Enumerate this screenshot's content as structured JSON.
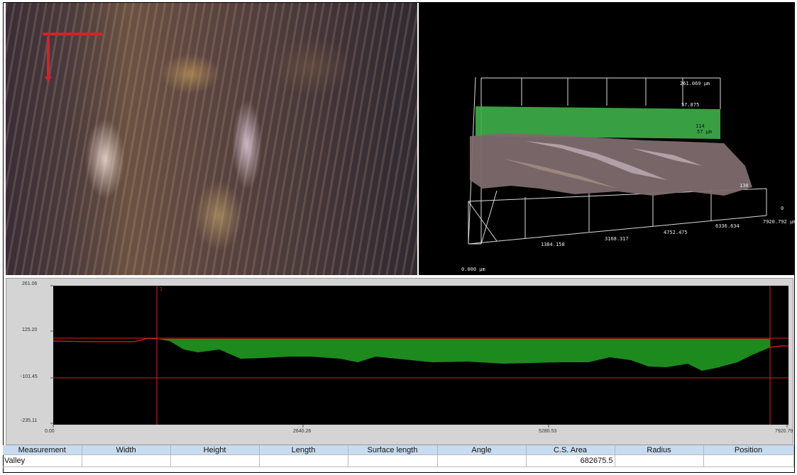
{
  "image_3d": {
    "z_top": "261.069 µm",
    "z_mid_a": "57.875",
    "z_mid_b": "114",
    "z_mid_c": "57 µm",
    "origin": "0.000 µm",
    "x_ticks": [
      "1384.158",
      "3168.317",
      "4752.475",
      "6336.634",
      "7920.792 µm"
    ],
    "y_end": "0",
    "side_label": "130"
  },
  "profile": {
    "y_ticks": [
      "261.06",
      "125.20",
      "-101.45",
      "-235.11"
    ],
    "x_ticks": [
      "0.00",
      "2640.26",
      "5280.53",
      "7920.79"
    ],
    "cursor_label": "1",
    "fill_color": "#1d8a1d",
    "line_color": "#e0201c"
  },
  "table": {
    "headers": [
      "Measurement",
      "Width",
      "Height",
      "Length",
      "Surface length",
      "Angle",
      "C.S. Area",
      "Radius",
      "Position"
    ],
    "rows": [
      [
        "Valley",
        "",
        "",
        "",
        "",
        "",
        "682675.5",
        "",
        ""
      ]
    ]
  }
}
